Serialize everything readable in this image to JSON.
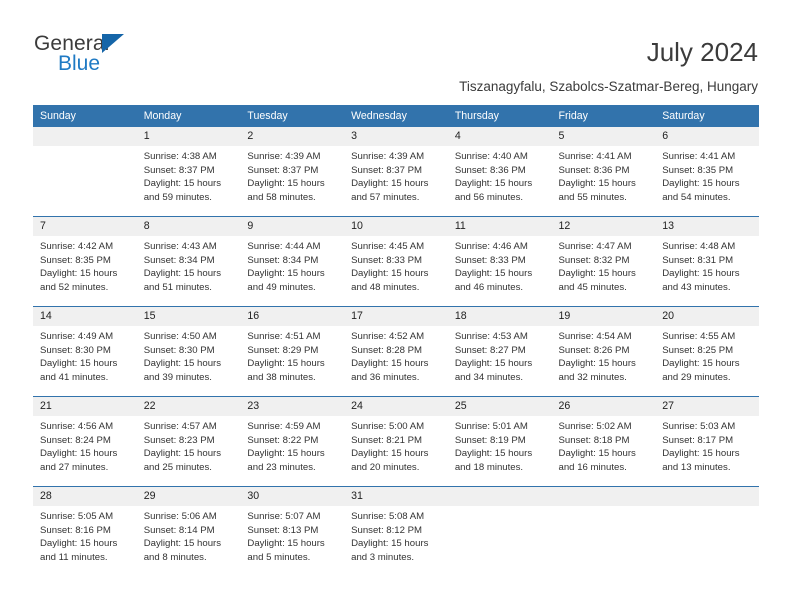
{
  "brand": {
    "word_general": "General",
    "word_blue": "Blue",
    "triangle_color": "#1565a8",
    "blue_color": "#1f7ac4"
  },
  "header": {
    "title": "July 2024",
    "subtitle": "Tiszanagyfalu, Szabolcs-Szatmar-Bereg, Hungary"
  },
  "theme": {
    "header_bg": "#3273ac",
    "daynum_bg": "#f0f0f0",
    "week_divider": "#3273ac",
    "text": "#333333"
  },
  "calendar": {
    "weekday_headers": [
      "Sunday",
      "Monday",
      "Tuesday",
      "Wednesday",
      "Thursday",
      "Friday",
      "Saturday"
    ],
    "weeks": [
      [
        {
          "day": "",
          "sunrise": "",
          "sunset": "",
          "daylight_line1": "",
          "daylight_line2": "",
          "empty": true
        },
        {
          "day": "1",
          "sunrise": "Sunrise: 4:38 AM",
          "sunset": "Sunset: 8:37 PM",
          "daylight_line1": "Daylight: 15 hours",
          "daylight_line2": "and 59 minutes."
        },
        {
          "day": "2",
          "sunrise": "Sunrise: 4:39 AM",
          "sunset": "Sunset: 8:37 PM",
          "daylight_line1": "Daylight: 15 hours",
          "daylight_line2": "and 58 minutes."
        },
        {
          "day": "3",
          "sunrise": "Sunrise: 4:39 AM",
          "sunset": "Sunset: 8:37 PM",
          "daylight_line1": "Daylight: 15 hours",
          "daylight_line2": "and 57 minutes."
        },
        {
          "day": "4",
          "sunrise": "Sunrise: 4:40 AM",
          "sunset": "Sunset: 8:36 PM",
          "daylight_line1": "Daylight: 15 hours",
          "daylight_line2": "and 56 minutes."
        },
        {
          "day": "5",
          "sunrise": "Sunrise: 4:41 AM",
          "sunset": "Sunset: 8:36 PM",
          "daylight_line1": "Daylight: 15 hours",
          "daylight_line2": "and 55 minutes."
        },
        {
          "day": "6",
          "sunrise": "Sunrise: 4:41 AM",
          "sunset": "Sunset: 8:35 PM",
          "daylight_line1": "Daylight: 15 hours",
          "daylight_line2": "and 54 minutes."
        }
      ],
      [
        {
          "day": "7",
          "sunrise": "Sunrise: 4:42 AM",
          "sunset": "Sunset: 8:35 PM",
          "daylight_line1": "Daylight: 15 hours",
          "daylight_line2": "and 52 minutes."
        },
        {
          "day": "8",
          "sunrise": "Sunrise: 4:43 AM",
          "sunset": "Sunset: 8:34 PM",
          "daylight_line1": "Daylight: 15 hours",
          "daylight_line2": "and 51 minutes."
        },
        {
          "day": "9",
          "sunrise": "Sunrise: 4:44 AM",
          "sunset": "Sunset: 8:34 PM",
          "daylight_line1": "Daylight: 15 hours",
          "daylight_line2": "and 49 minutes."
        },
        {
          "day": "10",
          "sunrise": "Sunrise: 4:45 AM",
          "sunset": "Sunset: 8:33 PM",
          "daylight_line1": "Daylight: 15 hours",
          "daylight_line2": "and 48 minutes."
        },
        {
          "day": "11",
          "sunrise": "Sunrise: 4:46 AM",
          "sunset": "Sunset: 8:33 PM",
          "daylight_line1": "Daylight: 15 hours",
          "daylight_line2": "and 46 minutes."
        },
        {
          "day": "12",
          "sunrise": "Sunrise: 4:47 AM",
          "sunset": "Sunset: 8:32 PM",
          "daylight_line1": "Daylight: 15 hours",
          "daylight_line2": "and 45 minutes."
        },
        {
          "day": "13",
          "sunrise": "Sunrise: 4:48 AM",
          "sunset": "Sunset: 8:31 PM",
          "daylight_line1": "Daylight: 15 hours",
          "daylight_line2": "and 43 minutes."
        }
      ],
      [
        {
          "day": "14",
          "sunrise": "Sunrise: 4:49 AM",
          "sunset": "Sunset: 8:30 PM",
          "daylight_line1": "Daylight: 15 hours",
          "daylight_line2": "and 41 minutes."
        },
        {
          "day": "15",
          "sunrise": "Sunrise: 4:50 AM",
          "sunset": "Sunset: 8:30 PM",
          "daylight_line1": "Daylight: 15 hours",
          "daylight_line2": "and 39 minutes."
        },
        {
          "day": "16",
          "sunrise": "Sunrise: 4:51 AM",
          "sunset": "Sunset: 8:29 PM",
          "daylight_line1": "Daylight: 15 hours",
          "daylight_line2": "and 38 minutes."
        },
        {
          "day": "17",
          "sunrise": "Sunrise: 4:52 AM",
          "sunset": "Sunset: 8:28 PM",
          "daylight_line1": "Daylight: 15 hours",
          "daylight_line2": "and 36 minutes."
        },
        {
          "day": "18",
          "sunrise": "Sunrise: 4:53 AM",
          "sunset": "Sunset: 8:27 PM",
          "daylight_line1": "Daylight: 15 hours",
          "daylight_line2": "and 34 minutes."
        },
        {
          "day": "19",
          "sunrise": "Sunrise: 4:54 AM",
          "sunset": "Sunset: 8:26 PM",
          "daylight_line1": "Daylight: 15 hours",
          "daylight_line2": "and 32 minutes."
        },
        {
          "day": "20",
          "sunrise": "Sunrise: 4:55 AM",
          "sunset": "Sunset: 8:25 PM",
          "daylight_line1": "Daylight: 15 hours",
          "daylight_line2": "and 29 minutes."
        }
      ],
      [
        {
          "day": "21",
          "sunrise": "Sunrise: 4:56 AM",
          "sunset": "Sunset: 8:24 PM",
          "daylight_line1": "Daylight: 15 hours",
          "daylight_line2": "and 27 minutes."
        },
        {
          "day": "22",
          "sunrise": "Sunrise: 4:57 AM",
          "sunset": "Sunset: 8:23 PM",
          "daylight_line1": "Daylight: 15 hours",
          "daylight_line2": "and 25 minutes."
        },
        {
          "day": "23",
          "sunrise": "Sunrise: 4:59 AM",
          "sunset": "Sunset: 8:22 PM",
          "daylight_line1": "Daylight: 15 hours",
          "daylight_line2": "and 23 minutes."
        },
        {
          "day": "24",
          "sunrise": "Sunrise: 5:00 AM",
          "sunset": "Sunset: 8:21 PM",
          "daylight_line1": "Daylight: 15 hours",
          "daylight_line2": "and 20 minutes."
        },
        {
          "day": "25",
          "sunrise": "Sunrise: 5:01 AM",
          "sunset": "Sunset: 8:19 PM",
          "daylight_line1": "Daylight: 15 hours",
          "daylight_line2": "and 18 minutes."
        },
        {
          "day": "26",
          "sunrise": "Sunrise: 5:02 AM",
          "sunset": "Sunset: 8:18 PM",
          "daylight_line1": "Daylight: 15 hours",
          "daylight_line2": "and 16 minutes."
        },
        {
          "day": "27",
          "sunrise": "Sunrise: 5:03 AM",
          "sunset": "Sunset: 8:17 PM",
          "daylight_line1": "Daylight: 15 hours",
          "daylight_line2": "and 13 minutes."
        }
      ],
      [
        {
          "day": "28",
          "sunrise": "Sunrise: 5:05 AM",
          "sunset": "Sunset: 8:16 PM",
          "daylight_line1": "Daylight: 15 hours",
          "daylight_line2": "and 11 minutes."
        },
        {
          "day": "29",
          "sunrise": "Sunrise: 5:06 AM",
          "sunset": "Sunset: 8:14 PM",
          "daylight_line1": "Daylight: 15 hours",
          "daylight_line2": "and 8 minutes."
        },
        {
          "day": "30",
          "sunrise": "Sunrise: 5:07 AM",
          "sunset": "Sunset: 8:13 PM",
          "daylight_line1": "Daylight: 15 hours",
          "daylight_line2": "and 5 minutes."
        },
        {
          "day": "31",
          "sunrise": "Sunrise: 5:08 AM",
          "sunset": "Sunset: 8:12 PM",
          "daylight_line1": "Daylight: 15 hours",
          "daylight_line2": "and 3 minutes."
        },
        {
          "day": "",
          "sunrise": "",
          "sunset": "",
          "daylight_line1": "",
          "daylight_line2": "",
          "empty": true
        },
        {
          "day": "",
          "sunrise": "",
          "sunset": "",
          "daylight_line1": "",
          "daylight_line2": "",
          "empty": true
        },
        {
          "day": "",
          "sunrise": "",
          "sunset": "",
          "daylight_line1": "",
          "daylight_line2": "",
          "empty": true
        }
      ]
    ]
  }
}
